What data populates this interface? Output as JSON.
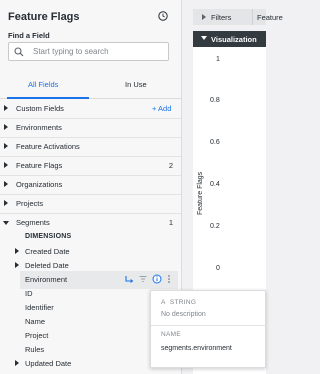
{
  "sidebar": {
    "title": "Feature Flags",
    "find_label": "Find a Field",
    "search_placeholder": "Start typing to search",
    "tabs": [
      {
        "label": "All Fields",
        "active": true
      },
      {
        "label": "In Use",
        "active": false
      }
    ],
    "views": [
      {
        "label": "Custom Fields",
        "action": "+ Add"
      },
      {
        "label": "Environments"
      },
      {
        "label": "Feature Activations"
      },
      {
        "label": "Feature Flags",
        "count": "2"
      },
      {
        "label": "Organizations"
      },
      {
        "label": "Projects"
      },
      {
        "label": "Segments",
        "count": "1",
        "expanded": true
      }
    ],
    "dimensions_header": "DIMENSIONS",
    "dimensions": [
      {
        "label": "Created Date",
        "expandable": true
      },
      {
        "label": "Deleted Date",
        "expandable": true
      },
      {
        "label": "Environment",
        "hovered": true
      },
      {
        "label": "ID"
      },
      {
        "label": "Identifier"
      },
      {
        "label": "Name"
      },
      {
        "label": "Project"
      },
      {
        "label": "Rules"
      },
      {
        "label": "Updated Date",
        "expandable": true
      }
    ]
  },
  "right": {
    "filters_label": "Filters",
    "filters_label_2": "Feature",
    "visualization_label": "Visualization",
    "y_axis_title": "Feature Flags",
    "y_ticks": [
      "1",
      "0.8",
      "0.6",
      "0.4",
      "0.2",
      "0"
    ]
  },
  "tooltip": {
    "type_label": "STRING",
    "description": "No description",
    "name_label": "NAME",
    "name_value": "segments.environment"
  },
  "colors": {
    "accent": "#1a73e8",
    "viz_bar": "#333a40"
  }
}
